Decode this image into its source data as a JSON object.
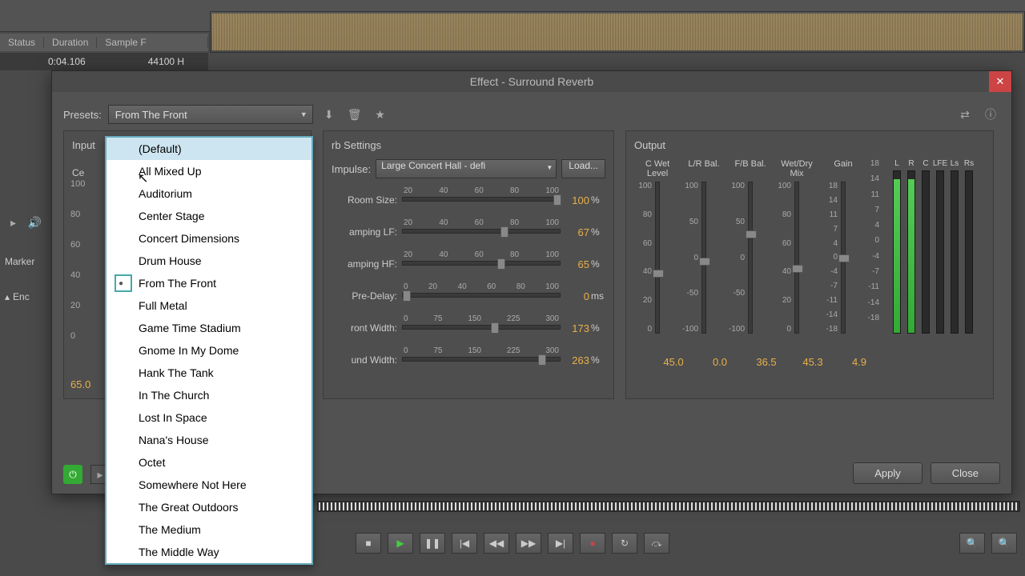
{
  "info": {
    "status": "Status",
    "duration_label": "Duration",
    "sample_label": "Sample F",
    "duration": "0:04.106",
    "sample": "44100 H"
  },
  "dialog_title": "Effect - Surround Reverb",
  "presets_label": "Presets:",
  "preset_selected": "From The Front",
  "preset_items": [
    {
      "label": "(Default)",
      "highlighted": true
    },
    {
      "label": "All Mixed Up"
    },
    {
      "label": "Auditorium"
    },
    {
      "label": "Center Stage"
    },
    {
      "label": "Concert Dimensions"
    },
    {
      "label": "Drum House"
    },
    {
      "label": "From The Front",
      "selected": true
    },
    {
      "label": "Full Metal"
    },
    {
      "label": "Game Time Stadium"
    },
    {
      "label": "Gnome In My Dome"
    },
    {
      "label": "Hank The Tank"
    },
    {
      "label": "In The Church"
    },
    {
      "label": "Lost In Space"
    },
    {
      "label": "Nana's House"
    },
    {
      "label": "Octet"
    },
    {
      "label": "Somewhere Not Here"
    },
    {
      "label": "The Great Outdoors"
    },
    {
      "label": "The Medium"
    },
    {
      "label": "The Middle Way"
    }
  ],
  "input_panel": "Input",
  "input_ce": "Ce",
  "input_65": "65.0",
  "reverb_panel": "rb Settings",
  "impulse_label": "Impulse:",
  "impulse_value": "Large Concert Hall - defi",
  "load_btn": "Load...",
  "reverb_rows": [
    {
      "label": "Room Size:",
      "ticks": [
        "20",
        "40",
        "60",
        "80",
        "100"
      ],
      "value": "100",
      "unit": "%",
      "thumb": 96
    },
    {
      "label": "amping LF:",
      "ticks": [
        "20",
        "40",
        "60",
        "80",
        "100"
      ],
      "value": "67",
      "unit": "%",
      "thumb": 62
    },
    {
      "label": "amping HF:",
      "ticks": [
        "20",
        "40",
        "60",
        "80",
        "100"
      ],
      "value": "65",
      "unit": "%",
      "thumb": 60
    },
    {
      "label": "Pre-Delay:",
      "ticks": [
        "0",
        "20",
        "40",
        "60",
        "80",
        "100"
      ],
      "value": "0",
      "unit": "ms",
      "thumb": 0
    },
    {
      "label": "ront Width:",
      "ticks": [
        "0",
        "75",
        "150",
        "225",
        "300"
      ],
      "value": "173",
      "unit": "%",
      "thumb": 56
    },
    {
      "label": "und Width:",
      "ticks": [
        "0",
        "75",
        "150",
        "225",
        "300"
      ],
      "value": "263",
      "unit": "%",
      "thumb": 86
    }
  ],
  "output_panel": "Output",
  "output_cols": [
    {
      "label": "C Wet\nLevel",
      "scale": [
        "100",
        "80",
        "60",
        "40",
        "20",
        "0"
      ],
      "thumb": 58,
      "value": "45.0"
    },
    {
      "label": "L/R Bal.",
      "scale": [
        "100",
        "50",
        "0",
        "-50",
        "-100"
      ],
      "thumb": 50,
      "value": "0.0"
    },
    {
      "label": "F/B Bal.",
      "scale": [
        "100",
        "50",
        "0",
        "-50",
        "-100"
      ],
      "thumb": 32,
      "value": "36.5"
    },
    {
      "label": "Wet/Dry\nMix",
      "scale": [
        "100",
        "80",
        "60",
        "40",
        "20",
        "0"
      ],
      "thumb": 55,
      "value": "45.3"
    },
    {
      "label": "Gain",
      "scale": [
        "18",
        "14",
        "11",
        "7",
        "4",
        "0",
        "-4",
        "-7",
        "-11",
        "-14",
        "-18"
      ],
      "thumb": 48,
      "value": "4.9"
    }
  ],
  "meters": [
    "L",
    "R",
    "C",
    "LFE",
    "Ls",
    "Rs"
  ],
  "meter_fills": [
    95,
    95,
    0,
    0,
    0,
    0
  ],
  "apply": "Apply",
  "close": "Close",
  "left": {
    "marker": "Marker",
    "enc": "Enc"
  }
}
